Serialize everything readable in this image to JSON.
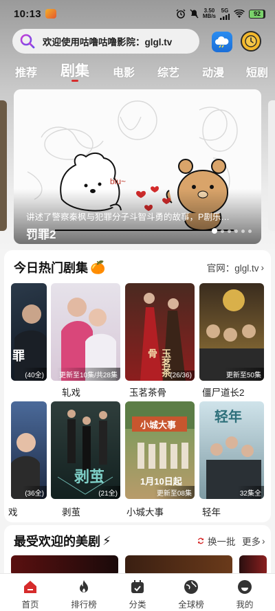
{
  "status_bar": {
    "time": "10:13",
    "net_speed_value": "3.50",
    "net_speed_unit": "MB/s",
    "signal": "5G",
    "battery": "92"
  },
  "search": {
    "text": "欢迎使用咕噜咕噜影院：glgl.tv"
  },
  "tabs": [
    {
      "label": "推荐"
    },
    {
      "label": "剧集",
      "active": true
    },
    {
      "label": "电影"
    },
    {
      "label": "综艺"
    },
    {
      "label": "动漫"
    },
    {
      "label": "短剧"
    }
  ],
  "banner": {
    "description": "讲述了警察秦枫与犯罪分子斗智斗勇的故事，P剧乐…",
    "title": "罚罪2",
    "art_text": "biu~",
    "slide_count": 6,
    "active_slide": 1
  },
  "hot_section": {
    "title": "今日热门剧集",
    "emoji": "🍊",
    "site_link": "官网：glgl.tv",
    "row1": [
      {
        "title": "",
        "badge": "(40全)"
      },
      {
        "title": "轧戏",
        "badge": "更新至10集/共28集"
      },
      {
        "title": "玉茗茶骨",
        "badge": "(26/36)"
      },
      {
        "title": "僵尸道长2",
        "badge": "更新至50集"
      }
    ],
    "row2": [
      {
        "title": "戏",
        "badge": "(36全)"
      },
      {
        "title": "剥茧",
        "badge": "(21全)"
      },
      {
        "title": "小城大事",
        "badge": "更新至08集"
      },
      {
        "title": "轻年",
        "badge": "32集全"
      }
    ],
    "poster_overlay": {
      "p1r1": "罪",
      "p3r1": "玉茗茶骨",
      "p2r2": "剥茧",
      "p3r2_date": "1月10日起",
      "p3r2_sign": "小城大事",
      "p4r2": "轻年"
    }
  },
  "us_section": {
    "title": "最受欢迎的美剧",
    "emoji": "⚡",
    "swap_label": "换一批",
    "more_label": "更多"
  },
  "bottom_nav": [
    {
      "label": "首页",
      "icon": "home-icon",
      "active": true
    },
    {
      "label": "排行榜",
      "icon": "flame-icon"
    },
    {
      "label": "分类",
      "icon": "calendar-icon"
    },
    {
      "label": "全球榜",
      "icon": "globe-icon"
    },
    {
      "label": "我的",
      "icon": "profile-icon"
    }
  ],
  "colors": {
    "accent": "#d62b2b",
    "home_active": "#d62b2b"
  }
}
